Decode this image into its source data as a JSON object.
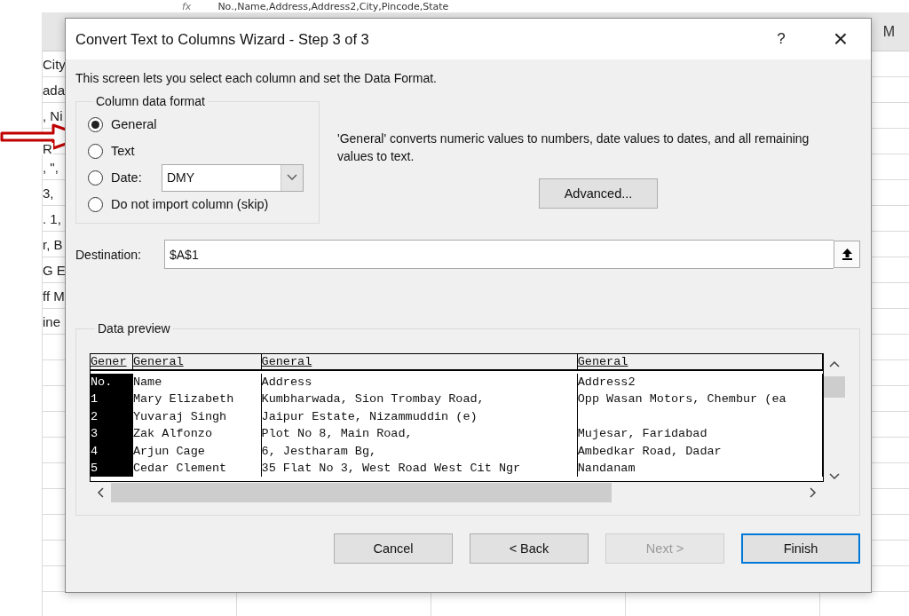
{
  "sheet": {
    "function_label": "fx",
    "formula": "No.,Name,Address,Address2,City,Pincode,State",
    "column_header": "M",
    "cells": [
      "City",
      "ada",
      ", Ni",
      "R",
      ", \",",
      "3,",
      ". 1,",
      "r, B",
      "G E",
      "ff M",
      "ine"
    ]
  },
  "dialog": {
    "title": "Convert Text to Columns Wizard - Step 3 of 3",
    "help": "?",
    "close": "×",
    "intro": "This screen lets you select each column and set the Data Format.",
    "format_group": {
      "title": "Column data format",
      "options": [
        {
          "label": "General",
          "selected": true
        },
        {
          "label": "Text",
          "selected": false
        },
        {
          "label": "Date:",
          "selected": false,
          "kind": "date",
          "value": "DMY"
        },
        {
          "label": "Do not import column (skip)",
          "selected": false
        }
      ]
    },
    "description": "'General' converts numeric values to numbers, date values to dates, and all remaining values to text.",
    "advanced_button": "Advanced...",
    "destination": {
      "label": "Destination:",
      "value": "$A$1"
    },
    "preview": {
      "title": "Data preview",
      "formats": [
        "Gener",
        "General",
        "General",
        "General"
      ],
      "rows": [
        [
          "No.",
          "Name",
          "Address",
          "Address2"
        ],
        [
          "1",
          "Mary Elizabeth",
          "Kumbharwada, Sion Trombay Road,",
          "Opp Wasan Motors, Chembur (ea"
        ],
        [
          "2",
          "Yuvaraj Singh",
          "Jaipur Estate, Nizammuddin (e)",
          ""
        ],
        [
          "3",
          "Zak Alfonzo",
          "Plot No 8, Main Road,",
          "Mujesar, Faridabad"
        ],
        [
          "4",
          "Arjun Cage",
          "6, Jestharam Bg,",
          "Ambedkar Road, Dadar"
        ],
        [
          "5",
          "Cedar Clement",
          "35 Flat No 3, West Road West Cit Ngr",
          "Nandanam"
        ]
      ]
    },
    "buttons": [
      {
        "label": "Cancel",
        "disabled": false,
        "default": false
      },
      {
        "label": "< Back",
        "disabled": false,
        "default": false
      },
      {
        "label": "Next >",
        "disabled": true,
        "default": false
      },
      {
        "label": "Finish",
        "disabled": false,
        "default": true
      }
    ]
  }
}
